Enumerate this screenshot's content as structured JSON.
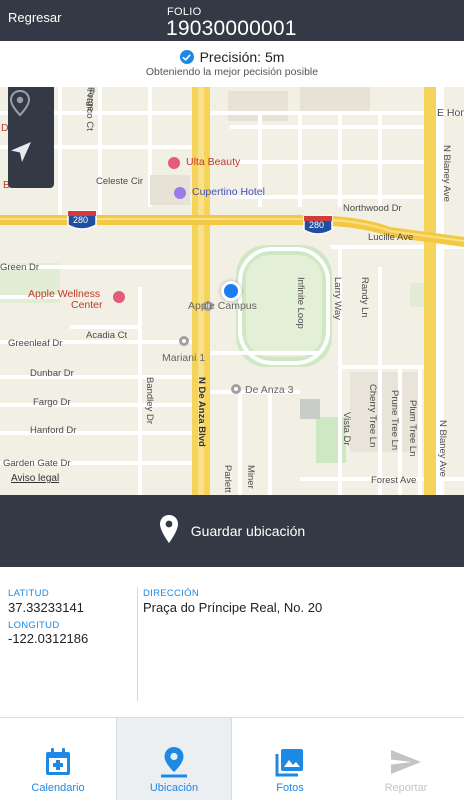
{
  "header": {
    "back_label": "Regresar",
    "folio_label": "FOLIO",
    "folio_value": "19030000001"
  },
  "precision": {
    "text": "Precisión: 5m",
    "subtitle": "Obteniendo la mejor pecisión posible"
  },
  "map": {
    "labels": {
      "e_hom": "E Hom",
      "franco_ct": "Franco Ct",
      "forge": "Forge",
      "celeste_cir": "Celeste Cir",
      "ulta_beauty": "Ulta Beauty",
      "cupertino_hotel": "Cupertino Hotel",
      "northwood_dr": "Northwood Dr",
      "lucille_ave": "Lucille Ave",
      "n_blaney_ave_top": "N Blaney Ave",
      "interstate_left": "280",
      "interstate_right": "280",
      "green_dr": "Green Dr",
      "apple_wellness_1": "Apple Wellness",
      "apple_wellness_2": "Center",
      "apple_campus": "Apple Campus",
      "infinite_loop": "Infinite Loop",
      "larry_way": "Larry Way",
      "randy_ln": "Randy Ln",
      "acadia_ct": "Acadia Ct",
      "greenleaf_dr": "Greenleaf Dr",
      "mariani_1": "Mariani 1",
      "dunbar_dr": "Dunbar Dr",
      "bandley_dr": "Bandley Dr",
      "n_de_anza_blvd": "N De Anza Blvd",
      "de_anza_3": "De Anza 3",
      "fargo_dr": "Fargo Dr",
      "hanford_dr": "Hanford Dr",
      "vista_dr": "Vista Dr",
      "cherry_tree_ln": "Cherry Tree Ln",
      "prune_tree_ln": "Prune Tree Ln",
      "plum_tree_ln": "Plum Tree Ln",
      "n_blaney_ave_bottom": "N Blaney Ave",
      "garden_gate_dr": "Garden Gate Dr",
      "forest_ave": "Forest Ave",
      "parlett": "Parlett",
      "miner": "Miner",
      "bu": "Bu",
      "d": "D"
    },
    "legal_label": "Aviso legal",
    "controls": {
      "pin_icon": "location-pin-icon",
      "arrow_icon": "navigation-arrow-icon"
    }
  },
  "save": {
    "label": "Guardar ubicación"
  },
  "info": {
    "latitude_label": "LATITUD",
    "latitude_value": "37.33233141",
    "longitude_label": "LONGITUD",
    "longitude_value": "-122.0312186",
    "address_label": "DIRECCIÓN",
    "address_value": "Praça do Príncipe Real, No. 20"
  },
  "tabs": [
    {
      "label": "Calendario",
      "icon": "calendar-add-icon",
      "state": "normal"
    },
    {
      "label": "Ubicación",
      "icon": "location-pin-icon",
      "state": "active"
    },
    {
      "label": "Fotos",
      "icon": "photos-icon",
      "state": "normal"
    },
    {
      "label": "Reportar",
      "icon": "send-icon",
      "state": "disabled"
    }
  ],
  "colors": {
    "header_bg": "#333a45",
    "accent": "#1e88e5",
    "map_bg": "#f2efe4",
    "highway": "#f6d35b",
    "disabled": "#c4c4c4"
  }
}
